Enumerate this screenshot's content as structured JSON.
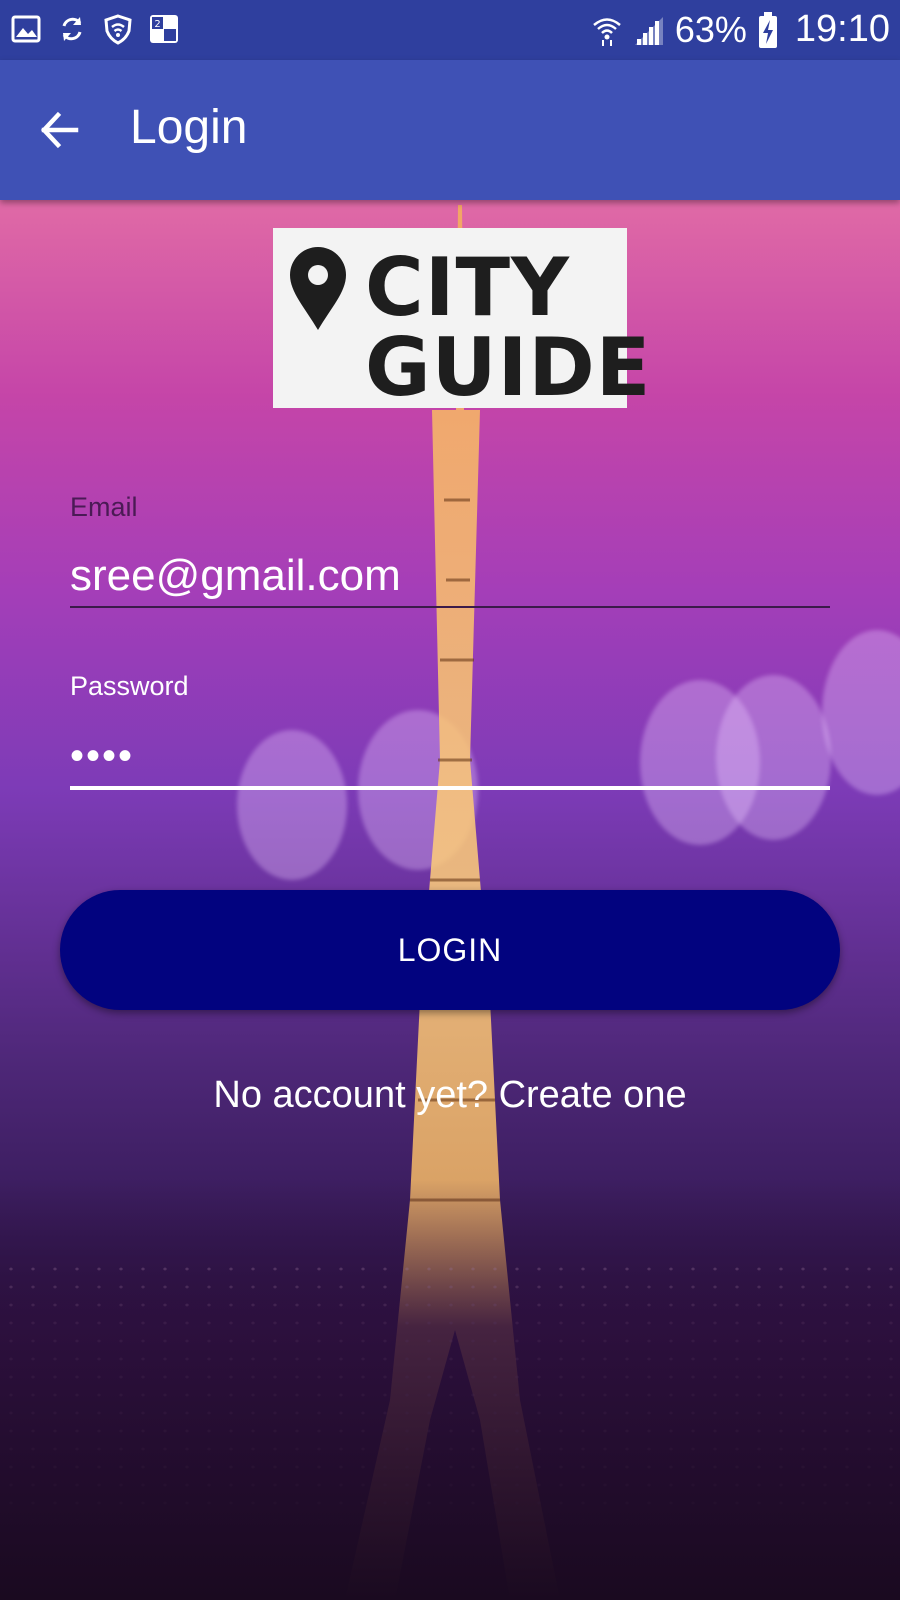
{
  "status_bar": {
    "icons_left": [
      "gallery-icon",
      "sync-icon",
      "shield-wifi-icon",
      "dual-sim-icon"
    ],
    "battery_percent": "63%",
    "time": "19:10"
  },
  "app_bar": {
    "title": "Login"
  },
  "logo": {
    "line1": "CITY",
    "line2": "GUIDE"
  },
  "form": {
    "email_label": "Email",
    "email_value": "sree@gmail.com",
    "password_label": "Password",
    "password_value": "••••"
  },
  "login_button": "LOGIN",
  "create_account_link": "No account yet? Create one",
  "colors": {
    "status_bar": "#2f3f9e",
    "app_bar": "#3f51b5",
    "login_button": "#02037f"
  }
}
